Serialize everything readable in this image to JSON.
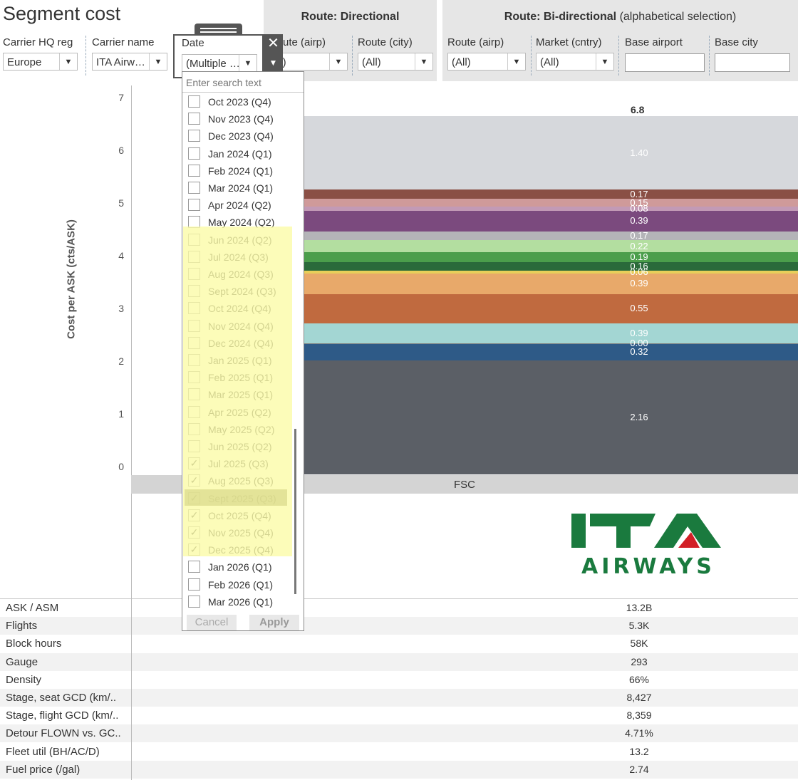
{
  "page": {
    "title": "Segment cost"
  },
  "header_groups": {
    "directional": {
      "label": "Route: Directional"
    },
    "bidirectional": {
      "label_bold": "Route: Bi-directional",
      "label_rest": "(alphabetical selection)"
    }
  },
  "filters": {
    "carrier_hq_reg": {
      "label": "Carrier HQ reg",
      "value": "Europe"
    },
    "carrier_name": {
      "label": "Carrier name",
      "value": "ITA Airw…"
    },
    "date": {
      "label": "Date",
      "value": "(Multiple …"
    },
    "route_airp_dir": {
      "label": "ute (airp)",
      "value": "ll)"
    },
    "route_city_dir": {
      "label": "Route (city)",
      "value": "(All)"
    },
    "route_airp_bi": {
      "label": "Route (airp)",
      "value": "(All)"
    },
    "market_cntry": {
      "label": "Market (cntry)",
      "value": "(All)"
    },
    "base_airport": {
      "label": "Base airport",
      "value": ""
    },
    "base_city": {
      "label": "Base city",
      "value": ""
    }
  },
  "date_popup": {
    "search_placeholder": "Enter search text",
    "options": [
      {
        "label": "Oct 2023 (Q4)",
        "checked": false
      },
      {
        "label": "Nov 2023 (Q4)",
        "checked": false
      },
      {
        "label": "Dec 2023 (Q4)",
        "checked": false
      },
      {
        "label": "Jan 2024 (Q1)",
        "checked": false
      },
      {
        "label": "Feb 2024 (Q1)",
        "checked": false
      },
      {
        "label": "Mar 2024 (Q1)",
        "checked": false
      },
      {
        "label": "Apr 2024 (Q2)",
        "checked": false
      },
      {
        "label": "May 2024 (Q2)",
        "checked": false
      },
      {
        "label": "Jun 2024 (Q2)",
        "checked": false
      },
      {
        "label": "Jul 2024 (Q3)",
        "checked": false
      },
      {
        "label": "Aug 2024 (Q3)",
        "checked": false
      },
      {
        "label": "Sept 2024 (Q3)",
        "checked": false
      },
      {
        "label": "Oct 2024 (Q4)",
        "checked": false
      },
      {
        "label": "Nov 2024 (Q4)",
        "checked": false
      },
      {
        "label": "Dec 2024 (Q4)",
        "checked": false
      },
      {
        "label": "Jan 2025 (Q1)",
        "checked": false
      },
      {
        "label": "Feb 2025 (Q1)",
        "checked": false
      },
      {
        "label": "Mar 2025 (Q1)",
        "checked": false
      },
      {
        "label": "Apr 2025 (Q2)",
        "checked": false
      },
      {
        "label": "May 2025 (Q2)",
        "checked": false
      },
      {
        "label": "Jun 2025 (Q2)",
        "checked": false
      },
      {
        "label": "Jul 2025 (Q3)",
        "checked": true
      },
      {
        "label": "Aug 2025 (Q3)",
        "checked": true
      },
      {
        "label": "Sept 2025 (Q3)",
        "checked": true
      },
      {
        "label": "Oct 2025 (Q4)",
        "checked": true
      },
      {
        "label": "Nov 2025 (Q4)",
        "checked": true
      },
      {
        "label": "Dec 2025 (Q4)",
        "checked": true
      },
      {
        "label": "Jan 2026 (Q1)",
        "checked": false
      },
      {
        "label": "Feb 2026 (Q1)",
        "checked": false
      },
      {
        "label": "Mar 2026 (Q1)",
        "checked": false
      }
    ],
    "cancel_label": "Cancel",
    "apply_label": "Apply",
    "close_glyph": "✕",
    "menu_glyph": "▼",
    "check_glyph": "✓"
  },
  "chart_data": {
    "type": "bar",
    "stacked": true,
    "categories": [
      "FSC"
    ],
    "ylabel": "Cost per ASK (cts/ASK)",
    "yticks": [
      "0",
      "1",
      "2",
      "3",
      "4",
      "5",
      "6",
      "7"
    ],
    "ylim": [
      0,
      7
    ],
    "total_label": "6.8",
    "segments": [
      {
        "value": 2.16,
        "label": "2.16",
        "color": "#5b5f66"
      },
      {
        "value": 0.32,
        "label": "0.32",
        "color": "#2e5a87"
      },
      {
        "value": 0.0,
        "label": "0.00",
        "color": "#7f7f7f"
      },
      {
        "value": 0.39,
        "label": "0.39",
        "color": "#a3d6d3"
      },
      {
        "value": 0.55,
        "label": "0.55",
        "color": "#c06a3f"
      },
      {
        "value": 0.39,
        "label": "0.39",
        "color": "#e8a96a"
      },
      {
        "value": 0.06,
        "label": "0.06",
        "color": "#e8cf5a"
      },
      {
        "value": 0.16,
        "label": "0.16",
        "color": "#2a6a3a"
      },
      {
        "value": 0.19,
        "label": "0.19",
        "color": "#4b9e4b"
      },
      {
        "value": 0.22,
        "label": "0.22",
        "color": "#b3dea0"
      },
      {
        "value": 0.17,
        "label": "0.17",
        "color": "#b4b4b8"
      },
      {
        "value": 0.39,
        "label": "0.39",
        "color": "#7b4a7e"
      },
      {
        "value": 0.08,
        "label": "0.08",
        "color": "#c29ab6"
      },
      {
        "value": 0.15,
        "label": "0.15",
        "color": "#cf9a9a"
      },
      {
        "value": 0.17,
        "label": "0.17",
        "color": "#8a4f45"
      },
      {
        "value": 1.4,
        "label": "1.40",
        "color": "#d6d8dc"
      }
    ],
    "grid": false
  },
  "metrics": [
    {
      "label": "ASK / ASM",
      "value": "13.2B"
    },
    {
      "label": "Flights",
      "value": "5.3K"
    },
    {
      "label": "Block hours",
      "value": "58K"
    },
    {
      "label": "Gauge",
      "value": "293"
    },
    {
      "label": "Density",
      "value": "66%"
    },
    {
      "label": "Stage, seat GCD (km/..",
      "value": "8,427"
    },
    {
      "label": "Stage, flight GCD (km/..",
      "value": "8,359"
    },
    {
      "label": "Detour FLOWN vs. GC..",
      "value": "4.71%"
    },
    {
      "label": "Fleet util (BH/AC/D)",
      "value": "13.2"
    },
    {
      "label": "Fuel price (/gal)",
      "value": "2.74"
    }
  ],
  "logo": {
    "text": "AIRWAYS",
    "mark": "ITA",
    "green": "#1a7a3e",
    "red": "#d21f26"
  }
}
